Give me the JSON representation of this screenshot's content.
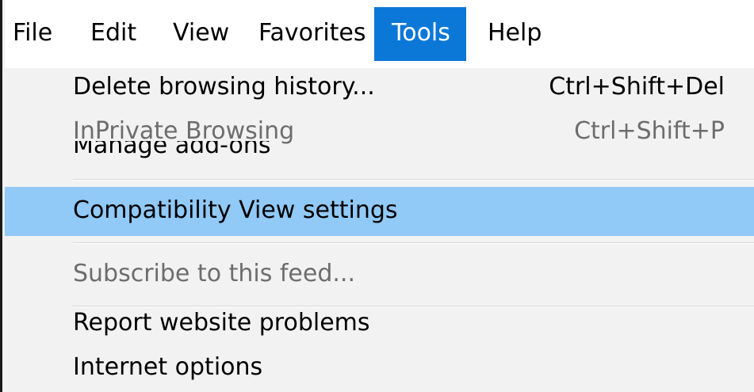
{
  "menubar": {
    "items": [
      {
        "label": "File"
      },
      {
        "label": "Edit"
      },
      {
        "label": "View"
      },
      {
        "label": "Favorites"
      },
      {
        "label": "Tools",
        "active": true
      },
      {
        "label": "Help"
      }
    ]
  },
  "tools_menu": {
    "items": [
      {
        "label": "Delete browsing history...",
        "shortcut": "Ctrl+Shift+Del"
      },
      {
        "label": "InPrivate Browsing",
        "shortcut": "Ctrl+Shift+P",
        "disabled": true
      },
      {
        "label": "Manage add-ons"
      },
      {
        "label": "Compatibility View settings",
        "highlighted": true
      },
      {
        "label": "Subscribe to this feed...",
        "disabled": true
      },
      {
        "label": "Report website problems"
      },
      {
        "label": "Internet options"
      }
    ]
  },
  "colors": {
    "menubar_active_bg": "#0b78d7",
    "menu_highlight_bg": "#91c9f7",
    "menu_bg": "#f2f2f2",
    "disabled_text": "#6d6d6d"
  }
}
